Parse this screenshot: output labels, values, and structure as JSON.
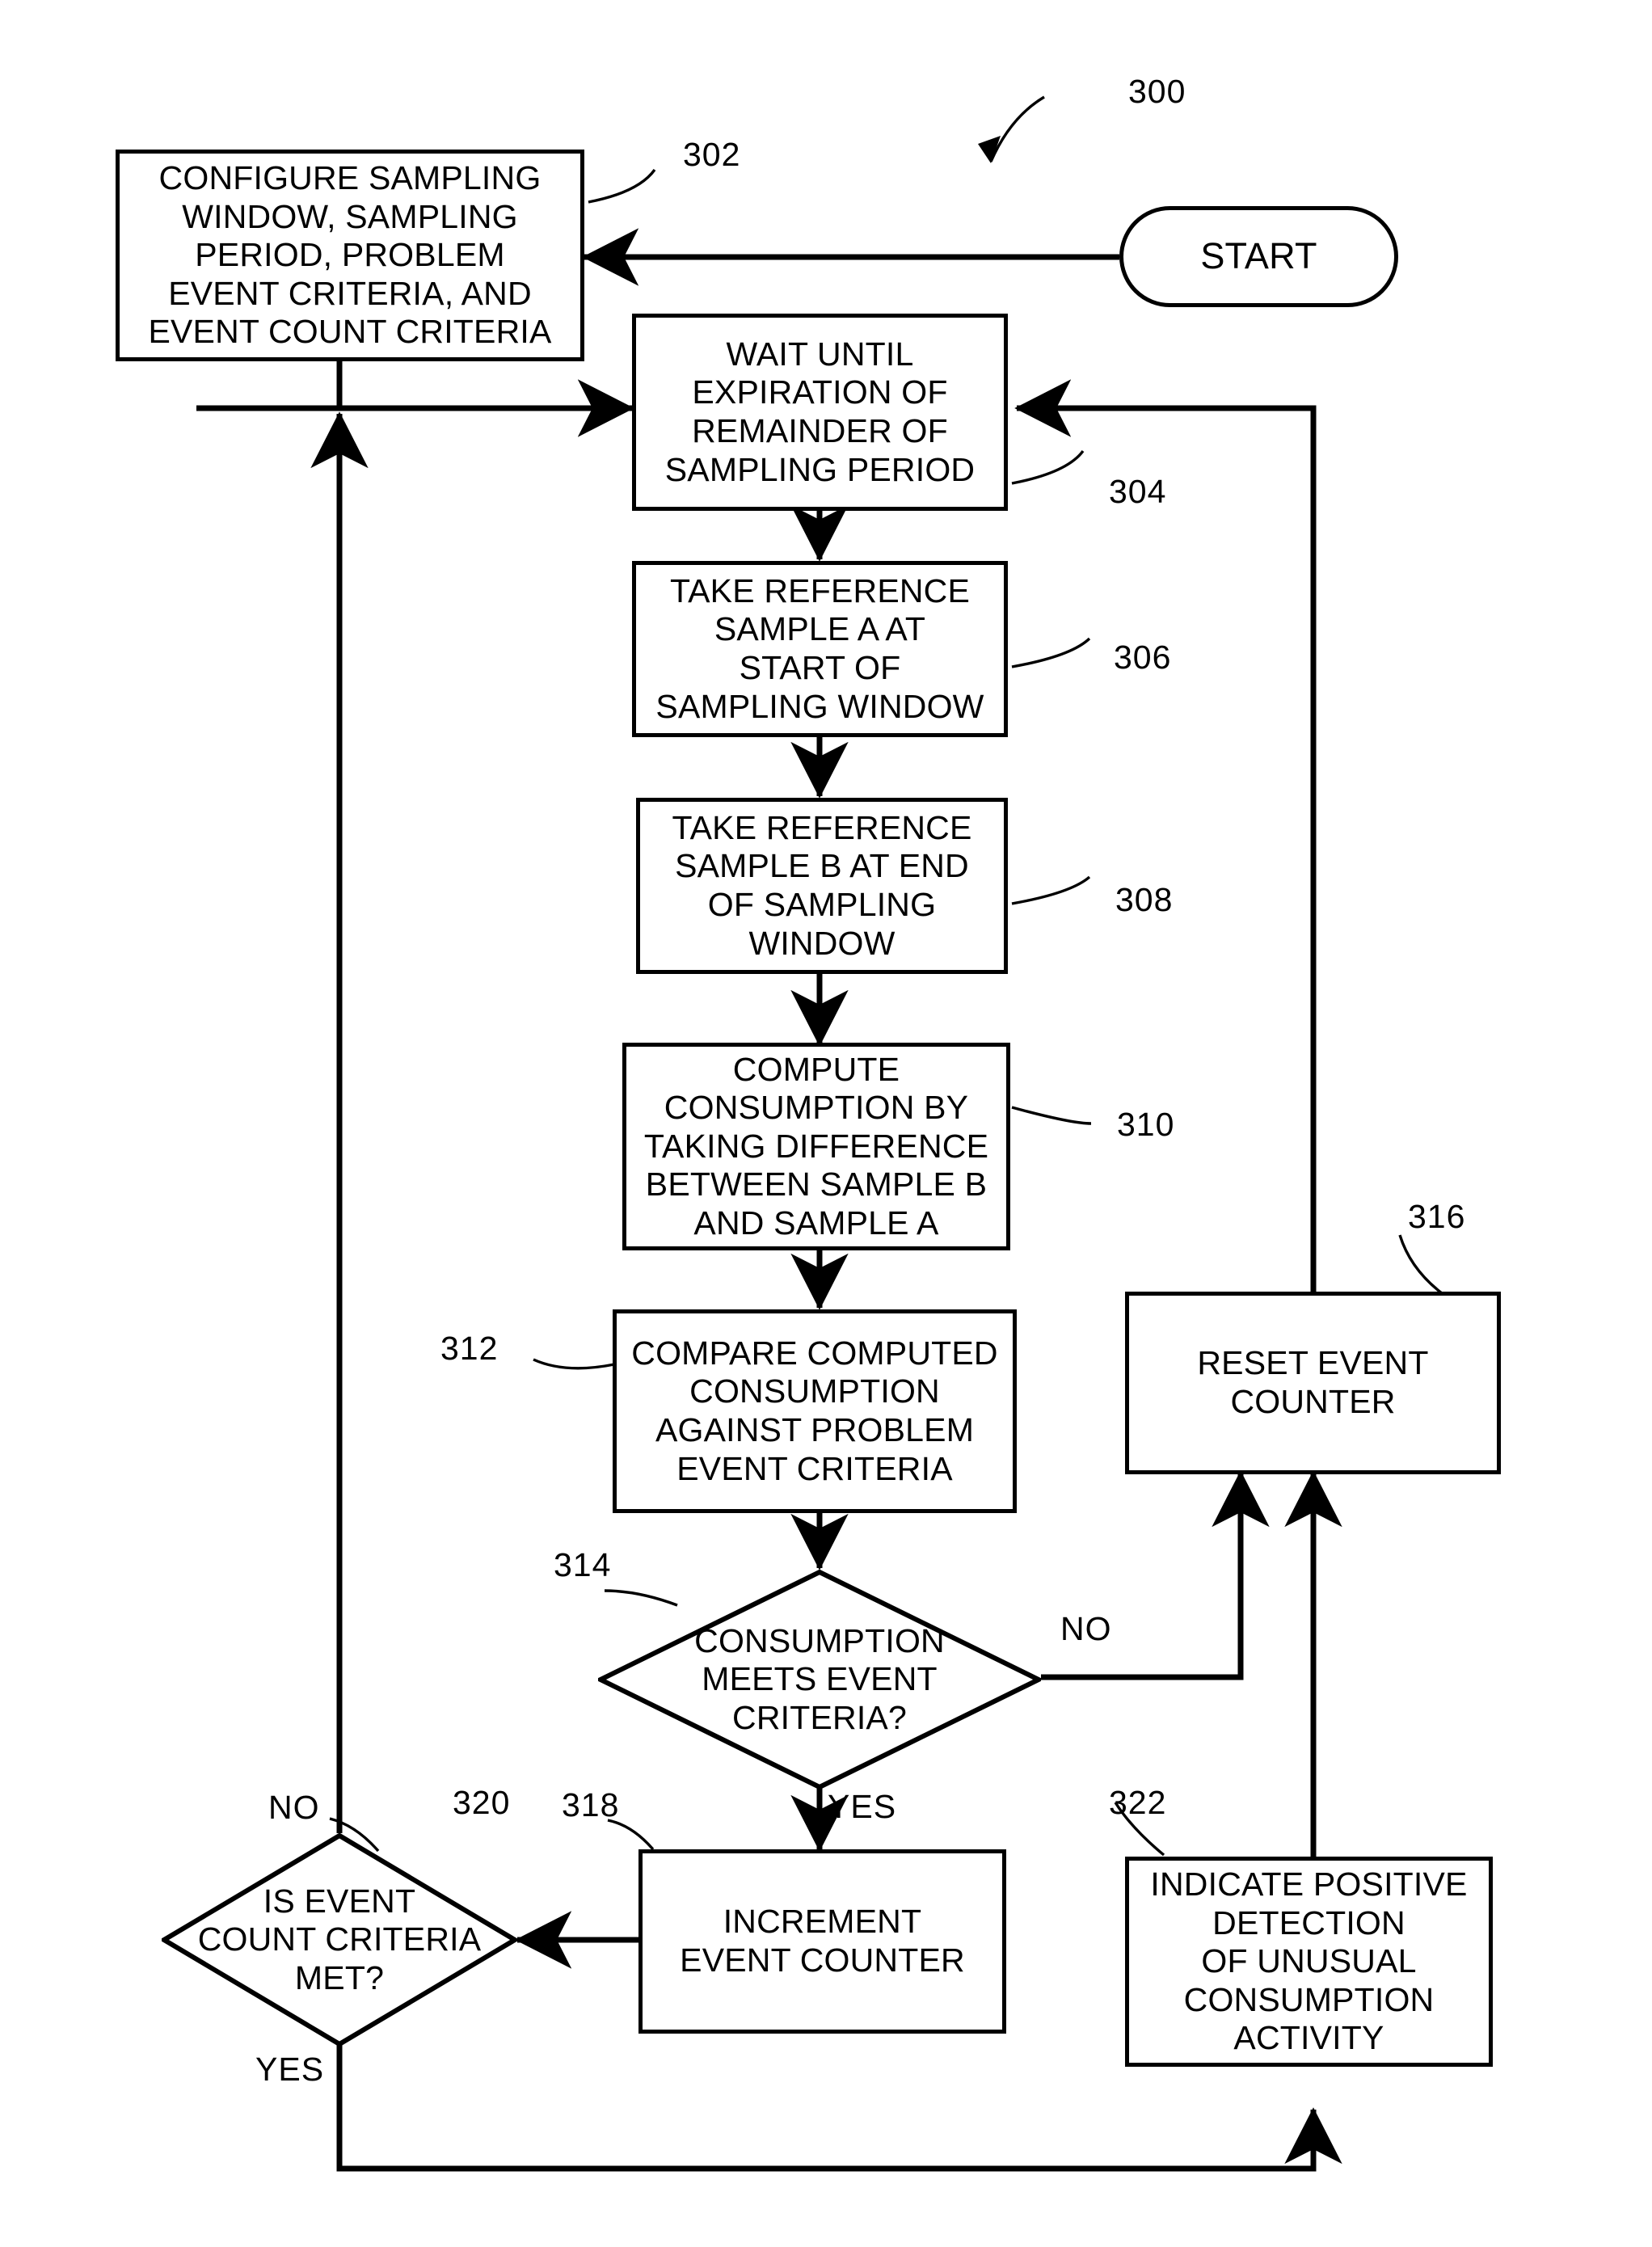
{
  "figure": {
    "number": "300",
    "type": "process-flowchart"
  },
  "nodes": {
    "start": {
      "ref": "300",
      "label": "START",
      "shape": "terminator"
    },
    "configure": {
      "ref": "302",
      "label": "CONFIGURE SAMPLING\nWINDOW, SAMPLING\nPERIOD, PROBLEM\nEVENT CRITERIA, AND\nEVENT COUNT CRITERIA",
      "shape": "process"
    },
    "wait": {
      "ref": "304",
      "label": "WAIT UNTIL\nEXPIRATION OF\nREMAINDER OF\nSAMPLING PERIOD",
      "shape": "process"
    },
    "sample_a": {
      "ref": "306",
      "label": "TAKE REFERENCE\nSAMPLE A AT\nSTART OF\nSAMPLING WINDOW",
      "shape": "process"
    },
    "sample_b": {
      "ref": "308",
      "label": "TAKE REFERENCE\nSAMPLE B AT END\nOF SAMPLING\nWINDOW",
      "shape": "process"
    },
    "compute": {
      "ref": "310",
      "label": "COMPUTE\nCONSUMPTION BY\nTAKING DIFFERENCE\nBETWEEN SAMPLE B\nAND SAMPLE A",
      "shape": "process"
    },
    "compare": {
      "ref": "312",
      "label": "COMPARE COMPUTED\nCONSUMPTION\nAGAINST PROBLEM\nEVENT CRITERIA",
      "shape": "process"
    },
    "meets_criteria": {
      "ref": "314",
      "label": "CONSUMPTION\nMEETS EVENT\nCRITERIA?",
      "shape": "decision"
    },
    "reset_counter": {
      "ref": "316",
      "label": "RESET EVENT\nCOUNTER",
      "shape": "process"
    },
    "increment_counter": {
      "ref": "318",
      "label": "INCREMENT\nEVENT COUNTER",
      "shape": "process"
    },
    "count_met": {
      "ref": "320",
      "label": "IS EVENT\nCOUNT CRITERIA\nMET?",
      "shape": "decision"
    },
    "indicate": {
      "ref": "322",
      "label": "INDICATE POSITIVE\nDETECTION\nOF UNUSUAL\nCONSUMPTION\nACTIVITY",
      "shape": "process"
    }
  },
  "edge_labels": {
    "meets_criteria_no": "NO",
    "meets_criteria_yes": "YES",
    "count_met_no": "NO",
    "count_met_yes": "YES"
  },
  "style": {
    "line_color": "#000000",
    "fill_color": "#ffffff",
    "text_color": "#000000"
  }
}
